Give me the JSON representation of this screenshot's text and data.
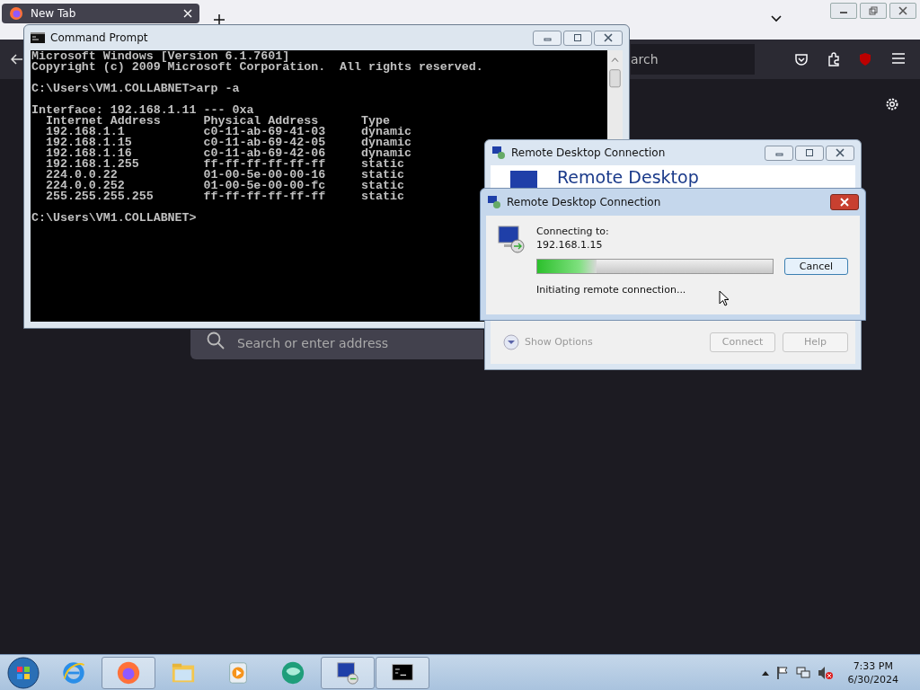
{
  "browser": {
    "tab": {
      "title": "New Tab",
      "selected": true
    },
    "toolbar_field": {
      "value": "arch"
    },
    "search": {
      "placeholder": "Search or enter address"
    }
  },
  "cmd": {
    "title": "Command Prompt",
    "blocks": [
      [
        "Microsoft Windows [Version 6.1.7601]",
        "Copyright (c) 2009 Microsoft Corporation.  All rights reserved."
      ],
      [
        "C:\\Users\\VM1.COLLABNET>arp -a"
      ],
      [
        "Interface: 192.168.1.11 --- 0xa",
        "  Internet Address      Physical Address      Type",
        "  192.168.1.1           c0-11-ab-69-41-03     dynamic",
        "  192.168.1.15          c0-11-ab-69-42-05     dynamic",
        "  192.168.1.16          c0-11-ab-69-42-06     dynamic",
        "  192.168.1.255         ff-ff-ff-ff-ff-ff     static",
        "  224.0.0.22            01-00-5e-00-00-16     static",
        "  224.0.0.252           01-00-5e-00-00-fc     static",
        "  255.255.255.255       ff-ff-ff-ff-ff-ff     static"
      ],
      [
        "C:\\Users\\VM1.COLLABNET>"
      ]
    ]
  },
  "rdc_main": {
    "title": "Remote Desktop Connection",
    "heading": "Remote Desktop",
    "show_options": "Show Options",
    "buttons": [
      {
        "label": "Connect",
        "disabled": true
      },
      {
        "label": "Help",
        "disabled": true
      }
    ]
  },
  "rdc_dialog": {
    "title": "Remote Desktop Connection",
    "connecting_label": "Connecting to:",
    "host": "192.168.1.15",
    "progress": {
      "level": 0.25
    },
    "status": "Initiating remote connection...",
    "cancel": "Cancel"
  },
  "taskbar": {
    "apps": [
      {
        "kind": "ie",
        "active": false
      },
      {
        "kind": "firefox",
        "active": true
      },
      {
        "kind": "explorer",
        "active": false
      },
      {
        "kind": "media",
        "active": false
      },
      {
        "kind": "green",
        "active": false
      },
      {
        "kind": "rdc",
        "active": true
      },
      {
        "kind": "cmd",
        "active": true
      }
    ],
    "time": "7:33 PM",
    "date": "6/30/2024"
  }
}
